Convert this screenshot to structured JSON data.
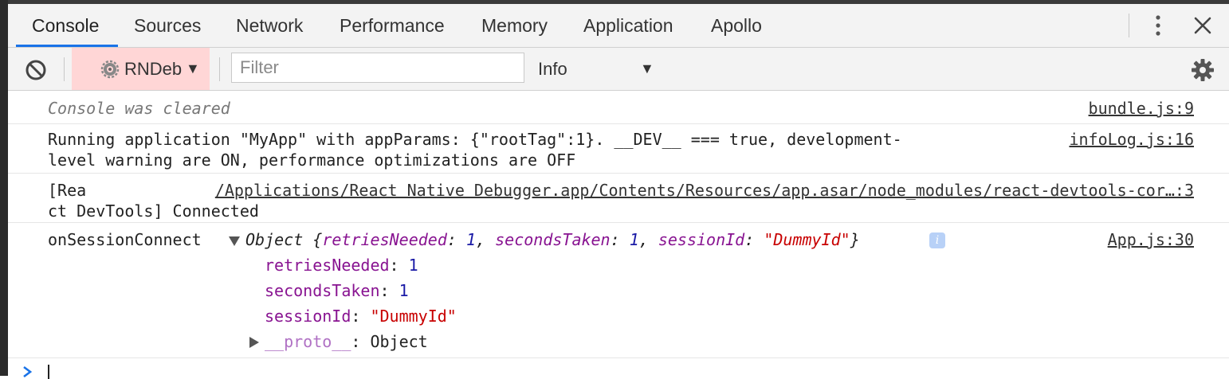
{
  "tabs": [
    {
      "label": "Console",
      "active": true
    },
    {
      "label": "Sources",
      "active": false
    },
    {
      "label": "Network",
      "active": false
    },
    {
      "label": "Performance",
      "active": false
    },
    {
      "label": "Memory",
      "active": false
    },
    {
      "label": "Application",
      "active": false
    },
    {
      "label": "Apollo",
      "active": false
    }
  ],
  "toolbar": {
    "context_label": "RNDeb",
    "context_caret": "▼",
    "filter_placeholder": "Filter",
    "level_label": "Info",
    "level_caret": "▼"
  },
  "messages": {
    "cleared": {
      "text": "Console was cleared",
      "source": "bundle.js:9"
    },
    "running": {
      "line1": "Running application \"MyApp\" with appParams: {\"rootTag\":1}. __DEV__ === true, development-",
      "line2": "level warning are ON, performance optimizations are OFF",
      "source": "infoLog.js:16"
    },
    "devtools": {
      "line1": "[Rea",
      "line2": "ct DevTools] Connected",
      "source": "/Applications/React Native Debugger.app/Contents/Resources/app.asar/node_modules/react-devtools-cor…:3"
    },
    "session": {
      "label": "onSessionConnect",
      "source": "App.js:30",
      "summary_prefix": "Object {",
      "summary_suffix": "}",
      "info_badge": "i",
      "props": [
        {
          "key": "retriesNeeded",
          "value": "1",
          "type": "number"
        },
        {
          "key": "secondsTaken",
          "value": "1",
          "type": "number"
        },
        {
          "key": "sessionId",
          "value": "\"DummyId\"",
          "type": "string"
        }
      ],
      "proto_key": "__proto__",
      "proto_value": "Object"
    }
  },
  "colors": {
    "accent": "#1a73e8",
    "context_bg": "#ffd6d6",
    "key": "#881391",
    "number": "#1a1aa6",
    "string": "#c80000"
  }
}
